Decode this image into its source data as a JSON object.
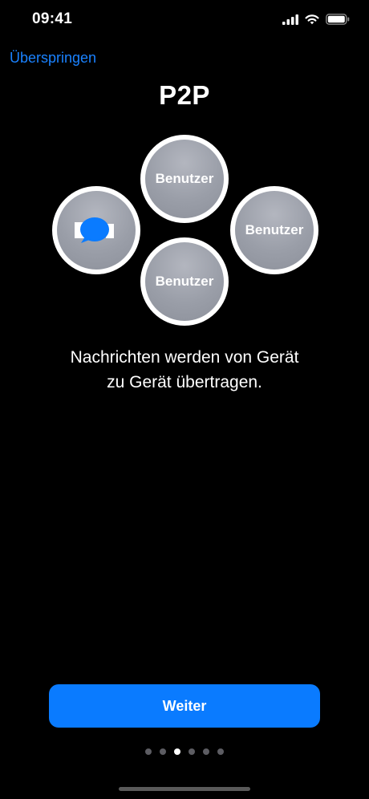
{
  "status_bar": {
    "time": "09:41",
    "icons": [
      "cellular-signal-icon",
      "wifi-icon",
      "battery-icon"
    ]
  },
  "header": {
    "skip_label": "Überspringen",
    "title": "P2P"
  },
  "diagram": {
    "peers": [
      {
        "position": "top",
        "label": "Benutzer"
      },
      {
        "position": "right",
        "label": "Benutzer"
      },
      {
        "position": "bottom",
        "label": "Benutzer"
      }
    ],
    "app_node": {
      "icon": "message-bubble-icon"
    }
  },
  "description": {
    "line1": "Nachrichten werden von Gerät",
    "line2": "zu Gerät übertragen."
  },
  "footer": {
    "next_label": "Weiter",
    "page_indicator": {
      "total": 6,
      "current": 3
    }
  },
  "colors": {
    "background": "#000000",
    "accent": "#0a7bff",
    "link": "#1a82ff",
    "peer_fill": "#9a9ea8",
    "dot_inactive": "#5d5d63",
    "dot_active": "#ffffff"
  }
}
